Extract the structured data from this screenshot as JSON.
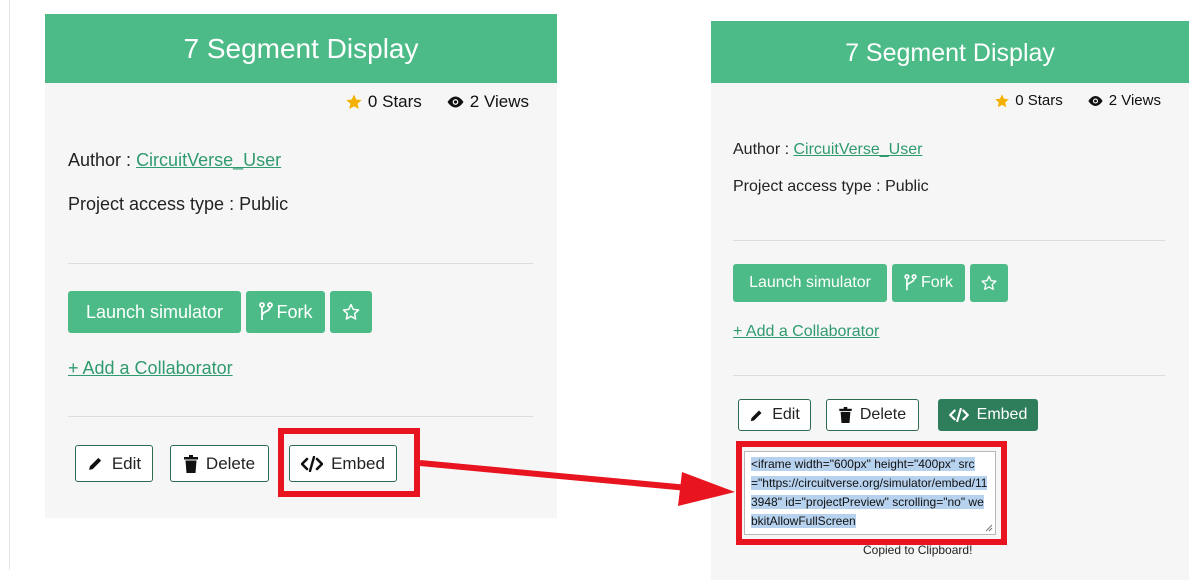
{
  "panels": [
    {
      "title": "7 Segment Display",
      "stars": "0 Stars",
      "views": "2 Views",
      "author_label": "Author :",
      "author_name": "CircuitVerse_User",
      "access_label": "Project access type :",
      "access_value": "Public",
      "launch_label": "Launch simulator",
      "fork_label": "Fork",
      "add_collaborator": "+ Add a Collaborator",
      "edit_label": "Edit",
      "delete_label": "Delete",
      "embed_label": "Embed"
    },
    {
      "title": "7 Segment Display",
      "stars": "0 Stars",
      "views": "2 Views",
      "author_label": "Author :",
      "author_name": "CircuitVerse_User",
      "access_label": "Project access type :",
      "access_value": "Public",
      "launch_label": "Launch simulator",
      "fork_label": "Fork",
      "add_collaborator": "+ Add a Collaborator",
      "edit_label": "Edit",
      "delete_label": "Delete",
      "embed_label": "Embed",
      "embed_code": "<iframe width=\"600px\" height=\"400px\" src=\"https://circuitverse.org/simulator/embed/113948\" id=\"projectPreview\" scrolling=\"no\" webkitAllowFullScreen",
      "copied_message": "Copied to Clipboard!"
    }
  ],
  "colors": {
    "brand_green": "#4cbb87",
    "dark_green": "#2e7d5b",
    "highlight_red": "#e8141f",
    "star_gold": "#f5b100"
  },
  "icons": [
    "star-icon",
    "eye-icon",
    "fork-icon",
    "star-outline-icon",
    "pencil-icon",
    "trash-icon",
    "code-icon"
  ]
}
